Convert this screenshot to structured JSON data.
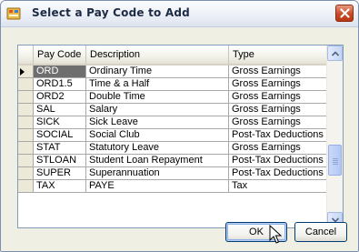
{
  "window": {
    "title": "Select a Pay Code to Add",
    "close_icon": "close-icon",
    "app_icon": "app-icon"
  },
  "grid": {
    "columns": [
      "Pay Code",
      "Description",
      "Type"
    ],
    "rows": [
      {
        "code": "ORD",
        "description": "Ordinary Time",
        "type": "Gross Earnings",
        "current": true
      },
      {
        "code": "ORD1.5",
        "description": "Time & a Half",
        "type": "Gross Earnings"
      },
      {
        "code": "ORD2",
        "description": "Double Time",
        "type": "Gross Earnings"
      },
      {
        "code": "SAL",
        "description": "Salary",
        "type": "Gross Earnings"
      },
      {
        "code": "SICK",
        "description": "Sick Leave",
        "type": "Gross Earnings"
      },
      {
        "code": "SOCIAL",
        "description": "Social Club",
        "type": "Post-Tax Deductions"
      },
      {
        "code": "STAT",
        "description": "Statutory Leave",
        "type": "Gross Earnings"
      },
      {
        "code": "STLOAN",
        "description": "Student Loan Repayment",
        "type": "Post-Tax Deductions"
      },
      {
        "code": "SUPER",
        "description": "Superannuation",
        "type": "Post-Tax Deductions"
      },
      {
        "code": "TAX",
        "description": "PAYE",
        "type": "Tax"
      }
    ],
    "scroll_position": 0.7
  },
  "buttons": {
    "ok": "OK",
    "cancel": "Cancel"
  },
  "colors": {
    "selected_cell": "#6e6e6e",
    "button_border": "#003c74"
  }
}
